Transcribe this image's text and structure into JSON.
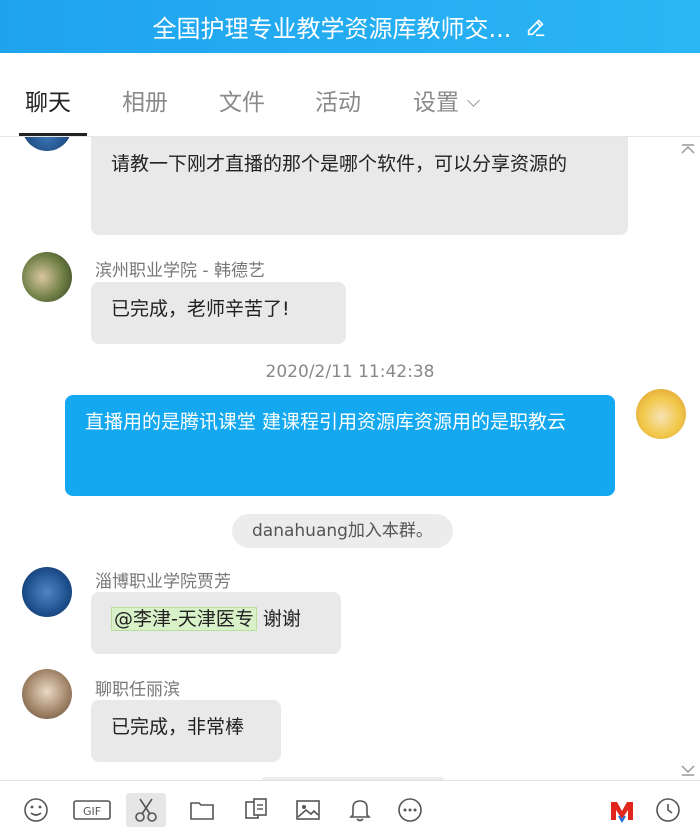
{
  "window": {
    "title": "全国护理专业教学资源库教师交..."
  },
  "tabs": [
    {
      "label": "聊天",
      "active": true
    },
    {
      "label": "相册"
    },
    {
      "label": "文件"
    },
    {
      "label": "活动"
    },
    {
      "label": "设置"
    }
  ],
  "messages": {
    "m1": {
      "text": "请教一下刚才直播的那个是哪个软件，可以分享资源的"
    },
    "m2": {
      "sender": "滨州职业学院 - 韩德艺",
      "text": "已完成，老师辛苦了!"
    },
    "timestamp": "2020/2/11 11:42:38",
    "m3": {
      "text": "直播用的是腾讯课堂  建课程引用资源库资源用的是职教云"
    },
    "system": "danahuang加入本群。",
    "m4": {
      "sender": "淄博职业学院贾芳",
      "mention": "@李津-天津医专",
      "text": "谢谢"
    },
    "m5": {
      "sender": "聊职任丽滨",
      "text": "已完成，非常棒"
    }
  },
  "toolbar": {
    "icons": [
      "emoji-icon",
      "gif-icon",
      "scissors-icon",
      "folder-icon",
      "file-transfer-icon",
      "image-icon",
      "bell-icon",
      "more-icon",
      "logo-icon",
      "history-icon"
    ],
    "gif_label": "GIF"
  },
  "colors": {
    "accent": "#13a8ef",
    "titlebar": "#1fa3ee",
    "bubble": "#e9e9e9"
  }
}
